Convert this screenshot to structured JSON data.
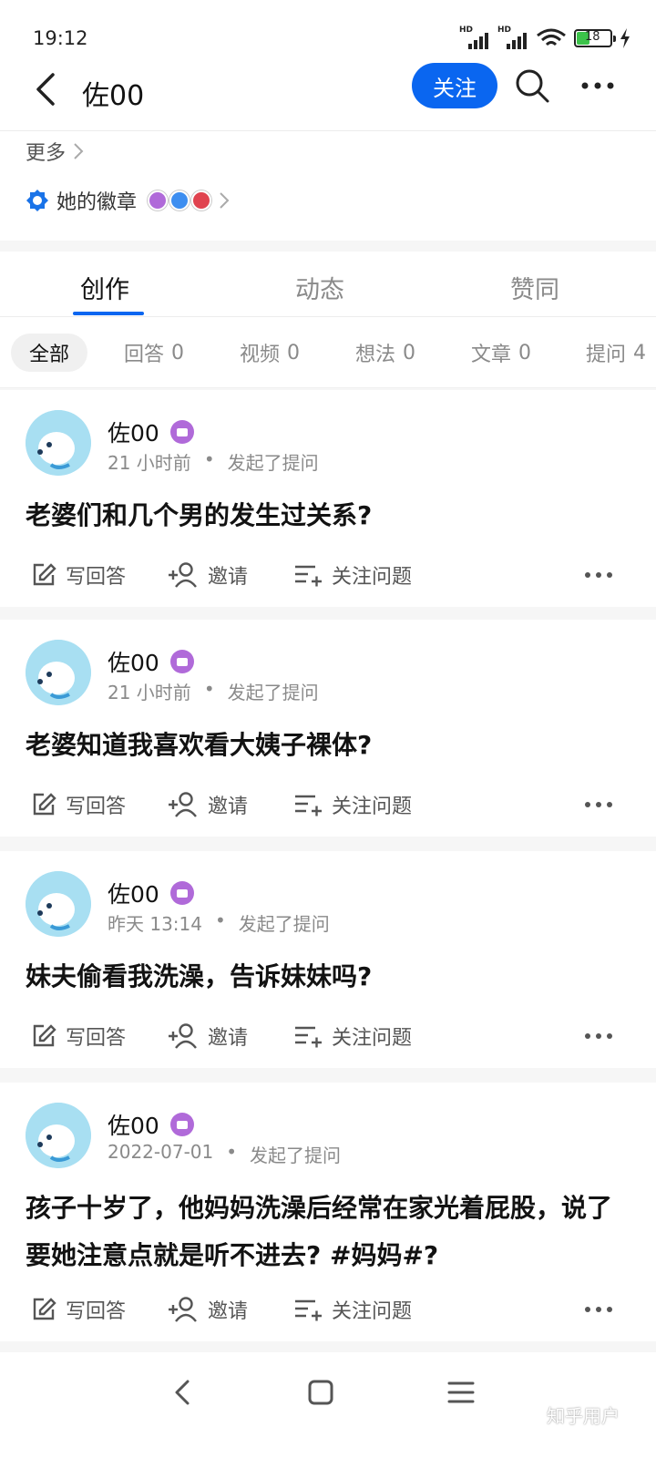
{
  "status_bar": {
    "time": "19:12",
    "battery": "18",
    "net1": "HD",
    "net2": "HD"
  },
  "header": {
    "title": "佐00",
    "follow_label": "关注"
  },
  "profile": {
    "more_label": "更多",
    "badge_label": "她的徽章"
  },
  "tabs": [
    {
      "label": "创作",
      "active": true
    },
    {
      "label": "动态",
      "active": false
    },
    {
      "label": "赞同",
      "active": false
    }
  ],
  "filters": [
    {
      "label": "全部",
      "count": ""
    },
    {
      "label": "回答",
      "count": "0"
    },
    {
      "label": "视频",
      "count": "0"
    },
    {
      "label": "想法",
      "count": "0"
    },
    {
      "label": "文章",
      "count": "0"
    },
    {
      "label": "提问",
      "count": "4"
    }
  ],
  "feed": [
    {
      "author": "佐00",
      "time": "21 小时前",
      "action": "发起了提问",
      "title": "老婆们和几个男的发生过关系?"
    },
    {
      "author": "佐00",
      "time": "21 小时前",
      "action": "发起了提问",
      "title": "老婆知道我喜欢看大姨子裸体?"
    },
    {
      "author": "佐00",
      "time": "昨天 13:14",
      "action": "发起了提问",
      "title": "妹夫偷看我洗澡，告诉妹妹吗?"
    },
    {
      "author": "佐00",
      "time": "2022-07-01",
      "action": "发起了提问",
      "title": "孩子十岁了，他妈妈洗澡后经常在家光着屁股，说了要她注意点就是听不进去? #妈妈#?"
    }
  ],
  "card_actions": {
    "answer": "写回答",
    "invite": "邀请",
    "follow_question": "关注问题"
  },
  "separator": "•",
  "watermark": "知乎用户",
  "colors": {
    "accent": "#0a66f0",
    "badge_purple": "#b06ad9"
  }
}
